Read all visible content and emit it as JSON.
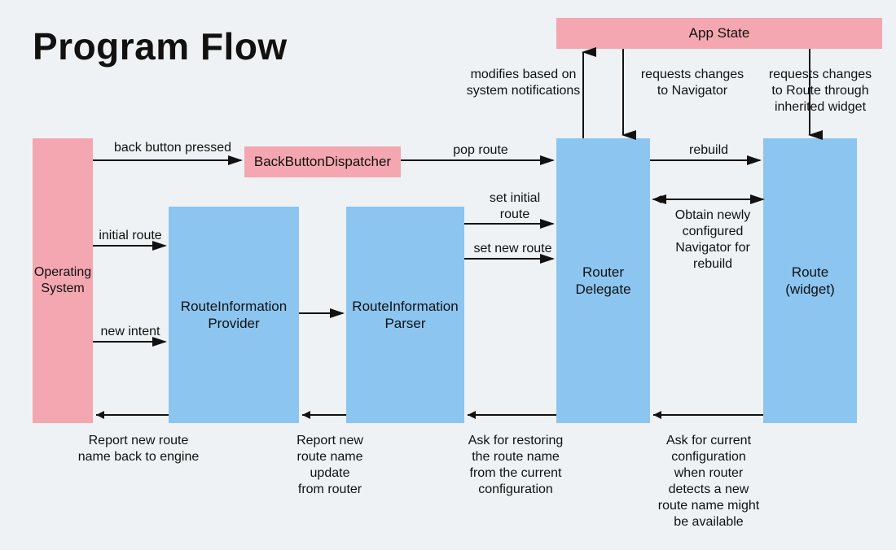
{
  "title": "Program Flow",
  "nodes": {
    "app_state": "App State",
    "back_button_dispatcher": "BackButtonDispatcher",
    "operating_system": "Operating\nSystem",
    "route_info_provider": "RouteInformation\nProvider",
    "route_info_parser": "RouteInformation\nParser",
    "router_delegate": "Router\nDelegate",
    "route_widget": "Route\n(widget)"
  },
  "labels": {
    "modifies_sys": "modifies based on\nsystem notifications",
    "req_navigator": "requests changes\nto Navigator",
    "req_route": "requests changes\nto Route through\ninherited widget",
    "back_pressed": "back button pressed",
    "pop_route": "pop route",
    "rebuild": "rebuild",
    "set_initial": "set initial\nroute",
    "set_new": "set new route",
    "obtain_nav": "Obtain newly\nconfigured\nNavigator for\nrebuild",
    "initial_route": "initial route",
    "new_intent": "new intent",
    "report_engine": "Report new route\nname back to engine",
    "report_router": "Report new\nroute name\nupdate\nfrom router",
    "ask_restore": "Ask for restoring\nthe route name\nfrom the current\nconfiguration",
    "ask_current": "Ask for current\nconfiguration\nwhen router\ndetects a new\nroute name might\nbe available"
  },
  "colors": {
    "pink": "#f4a7b0",
    "blue": "#8bc5f0",
    "bg": "#eef2f5"
  }
}
